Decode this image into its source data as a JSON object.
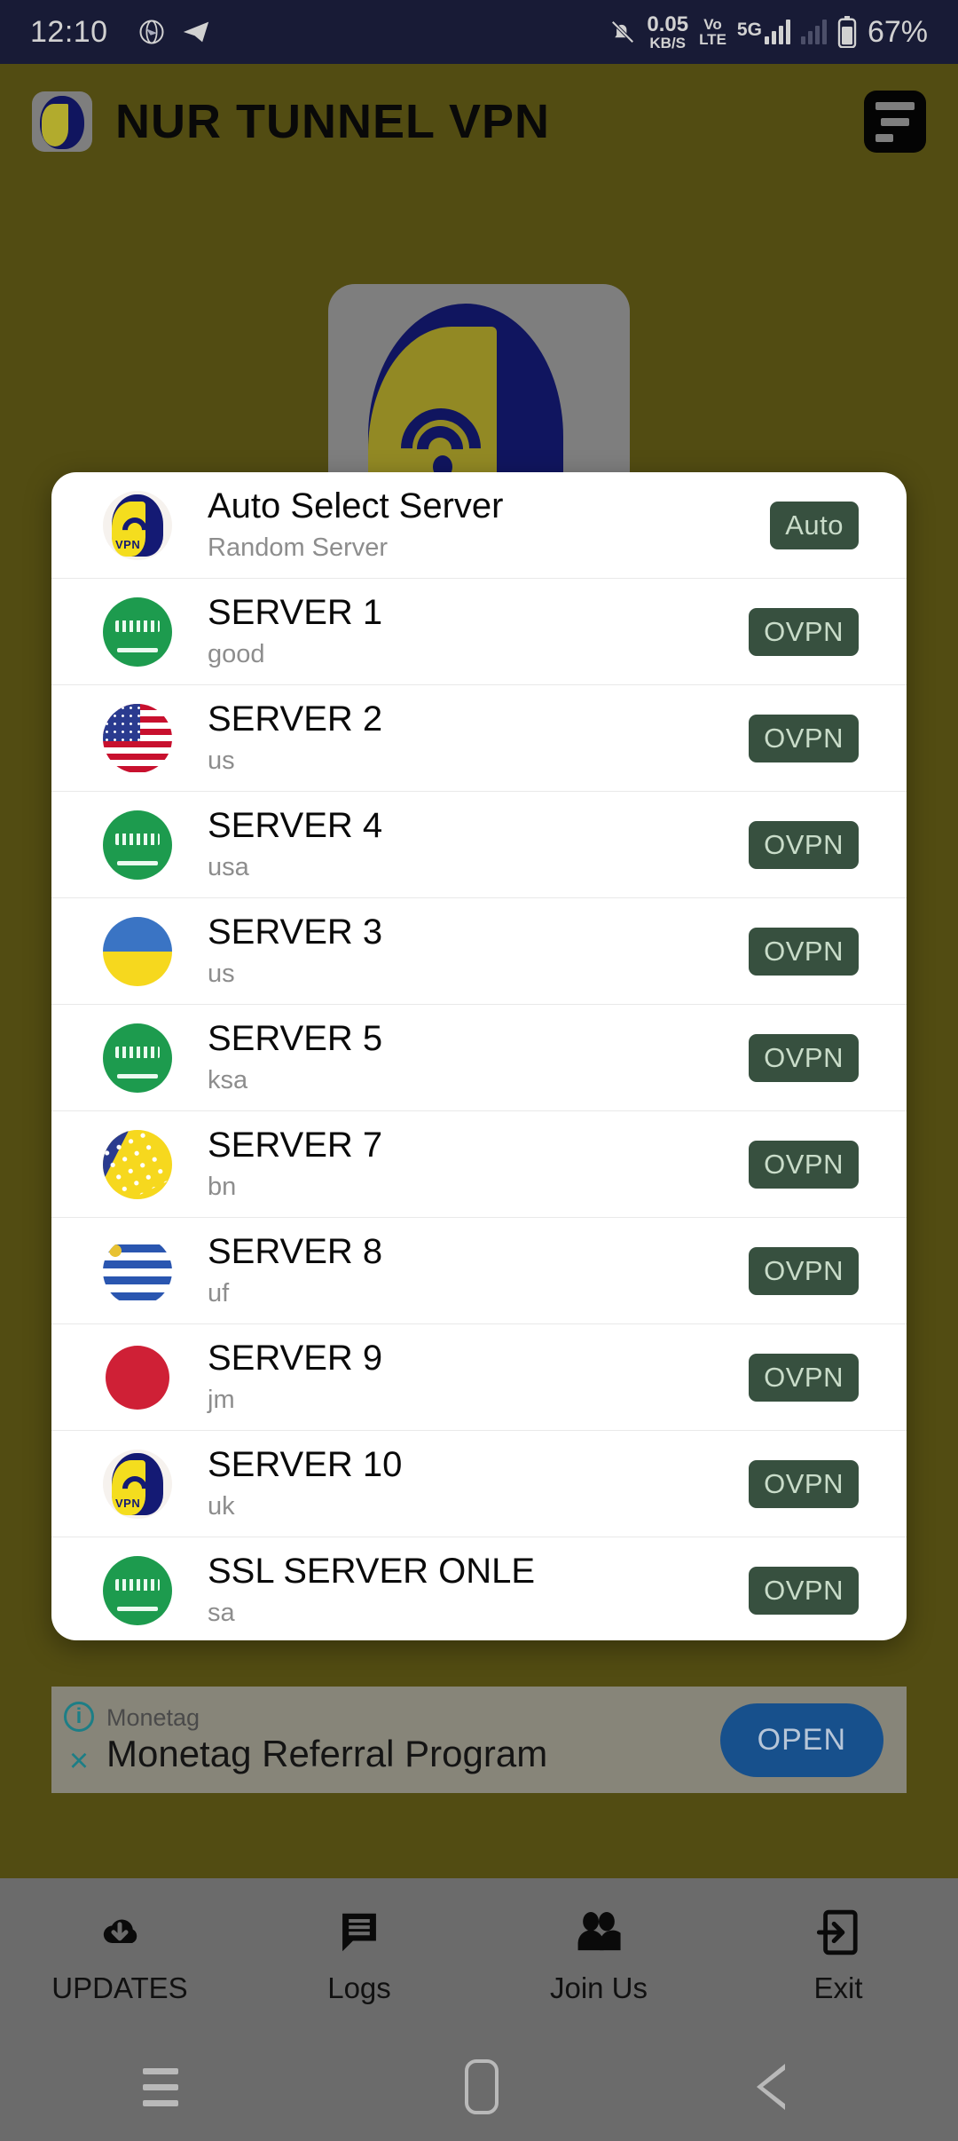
{
  "status_bar": {
    "clock": "12:10",
    "network_speed_value": "0.05",
    "network_speed_unit": "KB/S",
    "volte_line1": "Vo",
    "volte_line2": "LTE",
    "network_type": "5G",
    "battery": "67%",
    "icons": [
      "browser-icon",
      "telegram-icon",
      "bell-muted-icon",
      "signal-bars-icon",
      "battery-icon"
    ]
  },
  "header": {
    "title": "NUR TUNNEL VPN",
    "logo_name": "nur-tunnel-vpn-logo",
    "menu_icon": "sort-menu-icon"
  },
  "dialog": {
    "name": "server-selection-dialog",
    "rows": [
      {
        "name": "Auto Select Server",
        "sub": "Random Server",
        "badge": "Auto",
        "flag": "app"
      },
      {
        "name": "SERVER 1",
        "sub": "good",
        "badge": "OVPN",
        "flag": "ksa"
      },
      {
        "name": "SERVER 2",
        "sub": "us",
        "badge": "OVPN",
        "flag": "us"
      },
      {
        "name": "SERVER 4",
        "sub": "usa",
        "badge": "OVPN",
        "flag": "ksa"
      },
      {
        "name": "SERVER 3",
        "sub": "us",
        "badge": "OVPN",
        "flag": "ua"
      },
      {
        "name": "SERVER 5",
        "sub": "ksa",
        "badge": "OVPN",
        "flag": "ksa"
      },
      {
        "name": "SERVER 7",
        "sub": "bn",
        "badge": "OVPN",
        "flag": "ba"
      },
      {
        "name": "SERVER 8",
        "sub": "uf",
        "badge": "OVPN",
        "flag": "uy"
      },
      {
        "name": "SERVER 9",
        "sub": "jm",
        "badge": "OVPN",
        "flag": "jp"
      },
      {
        "name": "SERVER 10",
        "sub": "uk",
        "badge": "OVPN",
        "flag": "app"
      },
      {
        "name": "SSL SERVER ONLE",
        "sub": "sa",
        "badge": "OVPN",
        "flag": "ksa"
      }
    ]
  },
  "ad": {
    "advertiser": "Monetag",
    "headline": "Monetag Referral Program",
    "cta": "OPEN",
    "info_glyph": "i",
    "close_glyph": "×"
  },
  "bottom_nav": {
    "items": [
      {
        "label": "UPDATES",
        "icon": "cloud-download-icon"
      },
      {
        "label": "Logs",
        "icon": "chat-bubble-icon"
      },
      {
        "label": "Join Us",
        "icon": "people-icon"
      },
      {
        "label": "Exit",
        "icon": "exit-icon"
      }
    ]
  },
  "system_nav": {
    "recent_icon": "recent-apps-icon",
    "home_icon": "home-icon",
    "back_icon": "back-icon"
  },
  "colors": {
    "app_background": "#645D16",
    "status_bar": "#1E2142",
    "badge": "#37503F",
    "badge_text": "#C9DCC9",
    "nav_bar": "#6B6B6B",
    "ad_cta": "#17508C"
  }
}
